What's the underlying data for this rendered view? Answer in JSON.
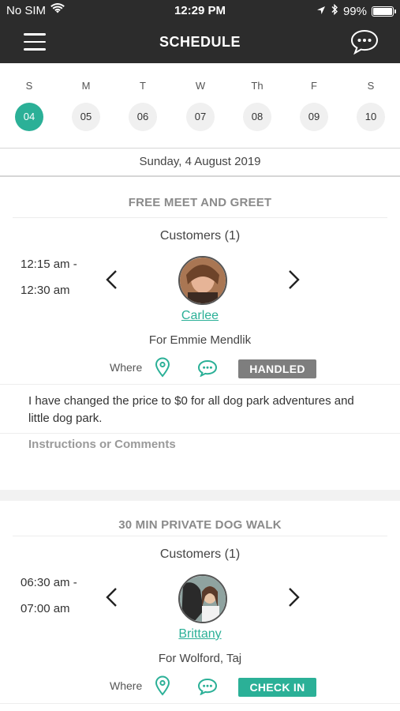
{
  "status_bar": {
    "carrier": "No SIM",
    "time": "12:29 PM",
    "battery": "99%"
  },
  "header": {
    "title": "SCHEDULE",
    "menu_icon": "hamburger-icon",
    "chat_icon": "chat-bubble-icon"
  },
  "week": [
    {
      "dow": "S",
      "date": "04",
      "selected": true
    },
    {
      "dow": "M",
      "date": "05"
    },
    {
      "dow": "T",
      "date": "06"
    },
    {
      "dow": "W",
      "date": "07"
    },
    {
      "dow": "Th",
      "date": "08"
    },
    {
      "dow": "F",
      "date": "09"
    },
    {
      "dow": "S",
      "date": "10"
    }
  ],
  "selected_date": "Sunday, 4 August 2019",
  "appointments": [
    {
      "title": "FREE MEET AND GREET",
      "customers_label": "Customers (1)",
      "time_start": "12:15 am -",
      "time_end": "12:30 am",
      "customer_name": "Carlee",
      "for_line": "For Emmie Mendlik",
      "where_label": "Where",
      "status": "HANDLED",
      "status_color": "#7e7e7e",
      "note": "I have changed the price to $0 for all dog park adventures and little dog park.",
      "instructions_placeholder": "Instructions or Comments"
    },
    {
      "title": "30 MIN PRIVATE DOG WALK",
      "customers_label": "Customers (1)",
      "time_start": "06:30 am -",
      "time_end": "07:00 am",
      "customer_name": "Brittany",
      "for_line": "For Wolford, Taj",
      "where_label": "Where",
      "status": "CHECK IN",
      "status_color": "#2bb097"
    }
  ],
  "colors": {
    "accent": "#2bb097",
    "header_bg": "#2c2c2c",
    "muted": "#8a8a8a"
  }
}
